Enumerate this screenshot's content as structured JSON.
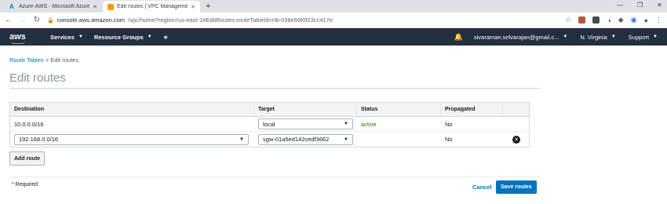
{
  "browser": {
    "tabs": [
      {
        "label": "Azure-AWS - Microsoft Azure",
        "icon": "azure-icon",
        "active": false
      },
      {
        "label": "Edit routes | VPC Management C",
        "icon": "aws-icon",
        "active": true
      }
    ],
    "url_host": "console.aws.amazon.com",
    "url_path": "/vpc/home?region=us-east-1#EditRoutes:routeTableId=rtb-038e66f0f23cc417e"
  },
  "aws_nav": {
    "logo": "aws",
    "services": "Services",
    "resource_groups": "Resource Groups",
    "user": "sivaraman.selvarajan@gmail.c...",
    "region": "N. Virginia",
    "support": "Support"
  },
  "breadcrumb": {
    "link": "Route Tables",
    "separator": " > ",
    "current": "Edit routes"
  },
  "page_title": "Edit routes",
  "table": {
    "headers": [
      "Destination",
      "Target",
      "Status",
      "Propagated"
    ],
    "rows": [
      {
        "destination": "10.0.0.0/16",
        "target": "local",
        "status": "active",
        "propagated": "No"
      },
      {
        "destination": "192.168.0.0/16",
        "target": "vgw-01a5ed142cedf3662",
        "status": "",
        "propagated": "No"
      }
    ]
  },
  "add_route": "Add route",
  "required_note": "* Required",
  "cancel": "Cancel",
  "save_routes": "Save routes",
  "colors": {
    "aws_nav_bg": "#232f3e",
    "primary": "#0073bb",
    "active_status": "#1d8102",
    "aws_orange": "#ff9900"
  }
}
